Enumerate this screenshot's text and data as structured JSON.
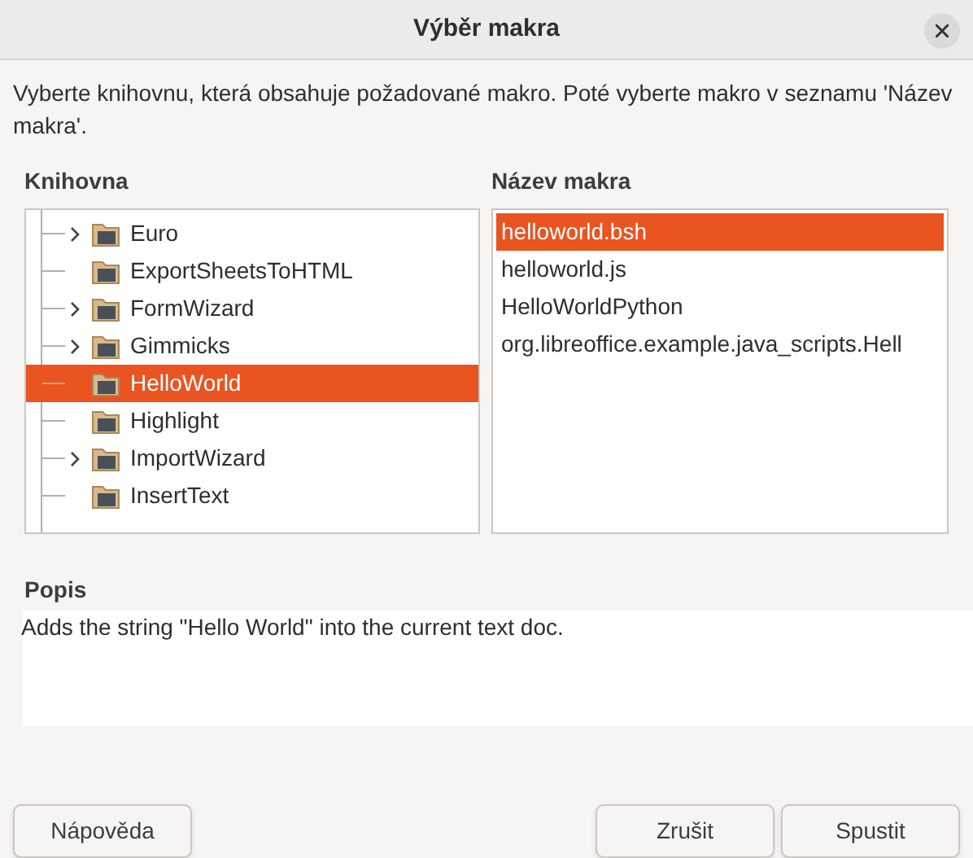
{
  "window": {
    "title": "Výběr makra"
  },
  "instruction": "Vyberte knihovnu, která obsahuje požadované makro. Poté vyberte makro v seznamu 'Název makra'.",
  "library": {
    "label": "Knihovna",
    "items": [
      {
        "label": "Euro",
        "expandable": true,
        "selected": false
      },
      {
        "label": "ExportSheetsToHTML",
        "expandable": false,
        "selected": false
      },
      {
        "label": "FormWizard",
        "expandable": true,
        "selected": false
      },
      {
        "label": "Gimmicks",
        "expandable": true,
        "selected": false
      },
      {
        "label": "HelloWorld",
        "expandable": false,
        "selected": true
      },
      {
        "label": "Highlight",
        "expandable": false,
        "selected": false
      },
      {
        "label": "ImportWizard",
        "expandable": true,
        "selected": false
      },
      {
        "label": "InsertText",
        "expandable": false,
        "selected": false
      }
    ]
  },
  "macros": {
    "label": "Název makra",
    "items": [
      {
        "label": "helloworld.bsh",
        "selected": true
      },
      {
        "label": "helloworld.js",
        "selected": false
      },
      {
        "label": "HelloWorldPython",
        "selected": false
      },
      {
        "label": "org.libreoffice.example.java_scripts.Hell",
        "selected": false
      }
    ]
  },
  "description": {
    "label": "Popis",
    "text": "Adds the string \"Hello World\" into the current text doc."
  },
  "buttons": {
    "help": "Nápověda",
    "cancel": "Zrušit",
    "run": "Spustit"
  }
}
